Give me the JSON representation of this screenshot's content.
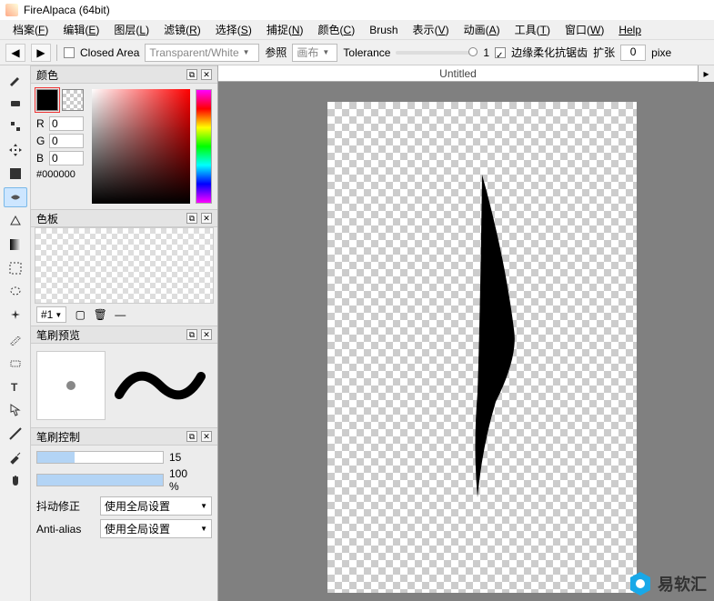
{
  "titlebar": {
    "title": "FireAlpaca (64bit)"
  },
  "menubar": {
    "items": [
      {
        "label": "档案",
        "key": "F"
      },
      {
        "label": "编辑",
        "key": "E"
      },
      {
        "label": "图层",
        "key": "L"
      },
      {
        "label": "滤镜",
        "key": "R"
      },
      {
        "label": "选择",
        "key": "S"
      },
      {
        "label": "捕捉",
        "key": "N"
      },
      {
        "label": "颜色",
        "key": "C"
      },
      {
        "label": "Brush",
        "key": ""
      },
      {
        "label": "表示",
        "key": "V"
      },
      {
        "label": "动画",
        "key": "A"
      },
      {
        "label": "工具",
        "key": "T"
      },
      {
        "label": "窗口",
        "key": "W"
      },
      {
        "label": "Help",
        "key": ""
      }
    ]
  },
  "toolbar": {
    "closed_area": "Closed Area",
    "transparent": "Transparent/White",
    "ref_label": "参照",
    "ref_value": "画布",
    "tolerance_label": "Tolerance",
    "tolerance_value": "1",
    "antialias": "边缘柔化抗锯齿",
    "expand_label": "扩张",
    "expand_value": "0",
    "expand_unit": "pixe"
  },
  "color_panel": {
    "title": "颜色",
    "r_label": "R",
    "r_value": "0",
    "g_label": "G",
    "g_value": "0",
    "b_label": "B",
    "b_value": "0",
    "hex": "#000000"
  },
  "palette_panel": {
    "title": "色板",
    "selector": "#1"
  },
  "brush_preview_panel": {
    "title": "笔刷预览"
  },
  "brush_ctrl_panel": {
    "title": "笔刷控制",
    "size_value": "15",
    "opacity_value": "100 %",
    "jitter_label": "抖动修正",
    "jitter_value": "使用全局设置",
    "aa_label": "Anti-alias",
    "aa_value": "使用全局设置"
  },
  "canvas": {
    "tab_title": "Untitled"
  },
  "watermark": {
    "text": "易软汇"
  }
}
